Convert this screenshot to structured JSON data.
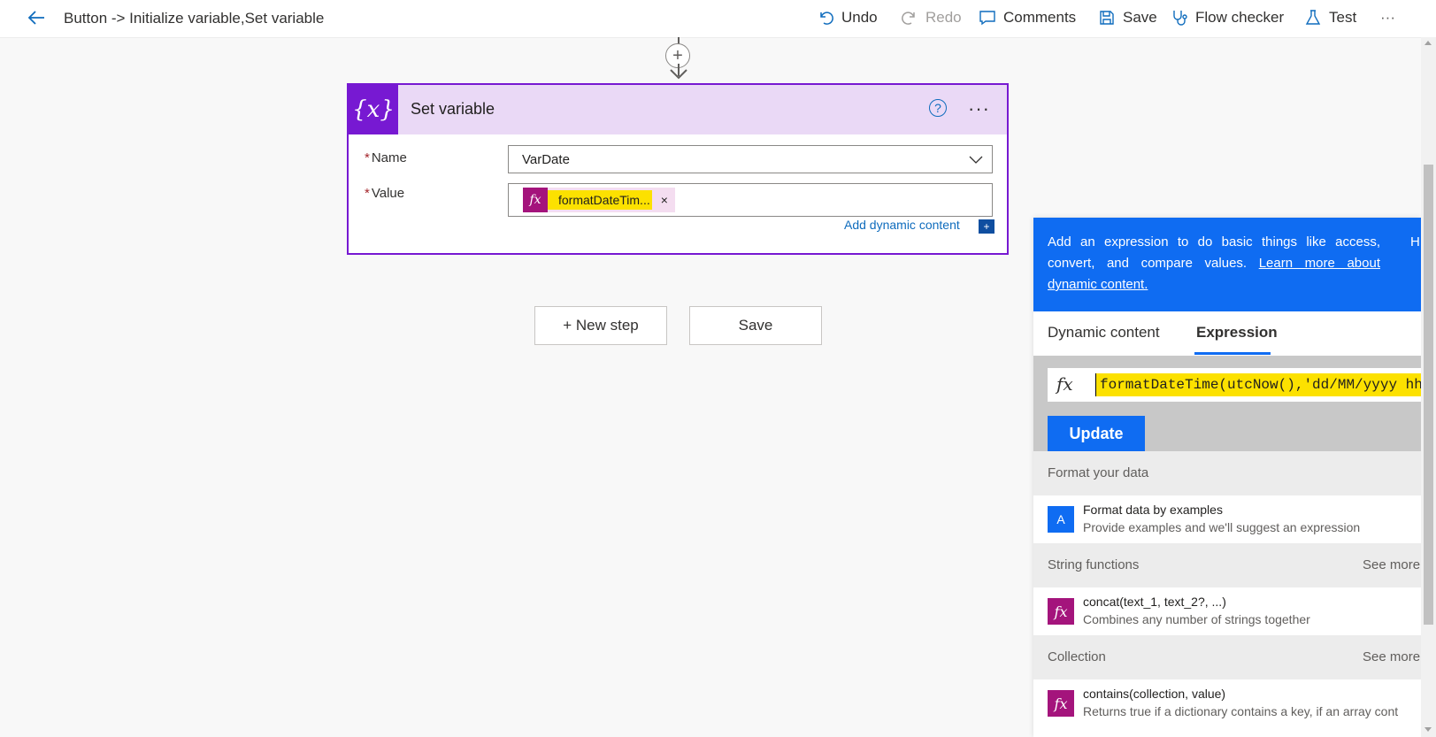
{
  "topbar": {
    "back_icon": "arrow-left-icon",
    "title": "Button -> Initialize variable,Set variable",
    "undo": "Undo",
    "redo": "Redo",
    "comments": "Comments",
    "save": "Save",
    "flow_checker": "Flow checker",
    "test": "Test",
    "more": "···"
  },
  "card": {
    "icon": "{x}",
    "title": "Set variable",
    "help": "?",
    "menu": "···",
    "name_label": "Name",
    "name_value": "VarDate",
    "value_label": "Value",
    "token_fx": "fx",
    "token_text": "formatDateTim...",
    "token_remove": "×",
    "add_dynamic": "Add dynamic content",
    "add_dynamic_plus": "+"
  },
  "buttons": {
    "new_step": "+ New step",
    "save": "Save"
  },
  "panel": {
    "info_text": "Add an expression to do basic things like access, convert, and compare values.",
    "info_link": "Learn more about dynamic content.",
    "info_h": "H",
    "tab_dynamic": "Dynamic content",
    "tab_expression": "Expression",
    "expr_fx": "fx",
    "expr_text": "formatDateTime(utcNow(),'dd/MM/yyyy hh",
    "update": "Update",
    "sections": {
      "format": {
        "label": "Format your data",
        "item_title": "Format data by examples",
        "item_desc": "Provide examples and we'll suggest an expression"
      },
      "string": {
        "label": "String functions",
        "more": "See more",
        "item_title": "concat(text_1, text_2?, ...)",
        "item_desc": "Combines any number of strings together"
      },
      "collection": {
        "label": "Collection",
        "more": "See more",
        "item_title": "contains(collection, value)",
        "item_desc": "Returns true if a dictionary contains a key, if an array cont"
      }
    }
  },
  "colors": {
    "accent_purple": "#7719d2",
    "card_header": "#ead9f6",
    "fx_magenta": "#a4147c",
    "highlight_yellow": "#fce100",
    "panel_blue": "#0f6cf2"
  }
}
